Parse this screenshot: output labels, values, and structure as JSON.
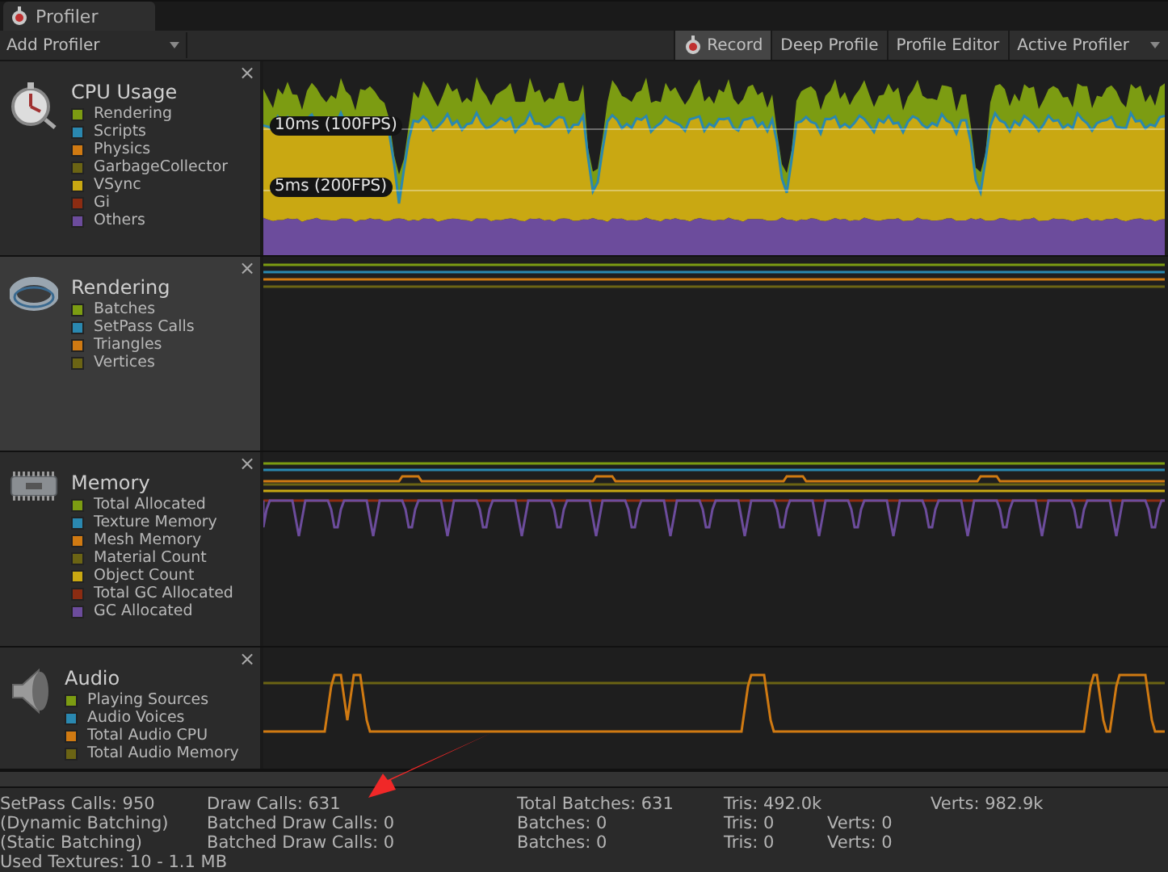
{
  "window": {
    "tab_title": "Profiler"
  },
  "toolbar": {
    "add_profiler": "Add Profiler",
    "buttons": [
      {
        "label": "Record",
        "kind": "record",
        "on": true
      },
      {
        "label": "Deep Profile",
        "kind": "toggle",
        "on": false
      },
      {
        "label": "Profile Editor",
        "kind": "toggle",
        "on": false
      },
      {
        "label": "Active Profiler",
        "kind": "dropdown",
        "on": false
      }
    ]
  },
  "modules": [
    {
      "title": "CPU Usage",
      "kind": "cpu",
      "selected": false,
      "close": "×",
      "legend": [
        {
          "label": "Rendering",
          "color": "#7c9c12"
        },
        {
          "label": "Scripts",
          "color": "#2a88b0"
        },
        {
          "label": "Physics",
          "color": "#d07a12"
        },
        {
          "label": "GarbageCollector",
          "color": "#6b6414"
        },
        {
          "label": "VSync",
          "color": "#c9a812"
        },
        {
          "label": "Gi",
          "color": "#8c2c12"
        },
        {
          "label": "Others",
          "color": "#6c4c9c"
        }
      ],
      "graph_labels": [
        "10ms (100FPS)",
        "5ms (200FPS)"
      ]
    },
    {
      "title": "Rendering",
      "kind": "rendering",
      "selected": true,
      "close": "×",
      "legend": [
        {
          "label": "Batches",
          "color": "#7c9c12"
        },
        {
          "label": "SetPass Calls",
          "color": "#2a88b0"
        },
        {
          "label": "Triangles",
          "color": "#d07a12"
        },
        {
          "label": "Vertices",
          "color": "#6b6414"
        }
      ]
    },
    {
      "title": "Memory",
      "kind": "memory",
      "selected": false,
      "close": "×",
      "legend": [
        {
          "label": "Total Allocated",
          "color": "#7c9c12"
        },
        {
          "label": "Texture Memory",
          "color": "#2a88b0"
        },
        {
          "label": "Mesh Memory",
          "color": "#d07a12"
        },
        {
          "label": "Material Count",
          "color": "#6b6414"
        },
        {
          "label": "Object Count",
          "color": "#c9a812"
        },
        {
          "label": "Total GC Allocated",
          "color": "#8c2c12"
        },
        {
          "label": "GC Allocated",
          "color": "#6c4c9c"
        }
      ]
    },
    {
      "title": "Audio",
      "kind": "audio",
      "selected": false,
      "close": "×",
      "legend": [
        {
          "label": "Playing Sources",
          "color": "#7c9c12"
        },
        {
          "label": "Audio Voices",
          "color": "#2a88b0"
        },
        {
          "label": "Total Audio CPU",
          "color": "#d07a12"
        },
        {
          "label": "Total Audio Memory",
          "color": "#6b6414"
        }
      ]
    }
  ],
  "stats": {
    "rows": [
      [
        "SetPass Calls: 950",
        "Draw Calls: 631",
        "Total Batches: 631",
        "Tris: 492.0k",
        null,
        "Verts: 982.9k"
      ],
      [
        "(Dynamic Batching)",
        "Batched Draw Calls: 0",
        "Batches: 0",
        "Tris: 0",
        "Verts: 0",
        null
      ],
      [
        "(Static Batching)",
        "Batched Draw Calls: 0",
        "Batches: 0",
        "Tris: 0",
        "Verts: 0",
        null
      ],
      [
        "Used Textures: 10 - 1.1 MB"
      ]
    ]
  }
}
